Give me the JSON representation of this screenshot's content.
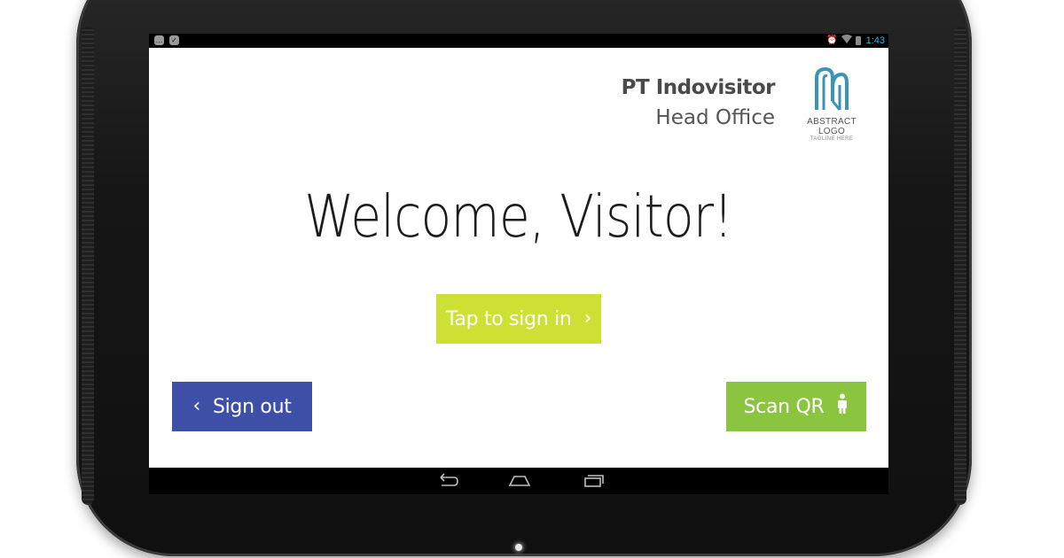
{
  "status_bar": {
    "time": "1:43",
    "notification_icons": [
      "chat-notification-icon",
      "checkbox-notification-icon"
    ],
    "system_icons": [
      "alarm-icon",
      "wifi-icon",
      "battery-icon"
    ]
  },
  "company": {
    "name": "PT Indovisitor",
    "branch": "Head Office"
  },
  "logo": {
    "text": "ABSTRACT LOGO",
    "tagline": "TAGLINE HERE",
    "color": "#3b93b8"
  },
  "welcome": {
    "text": "Welcome, Visitor!"
  },
  "buttons": {
    "sign_in": {
      "label": "Tap to sign in",
      "icon": "chevron-right-icon",
      "color": "#cde034"
    },
    "sign_out": {
      "label": "Sign out",
      "icon": "chevron-left-icon",
      "color": "#3e4fa8"
    },
    "scan_qr": {
      "label": "Scan QR",
      "icon": "person-icon",
      "color": "#8bc43f"
    }
  },
  "nav_bar": {
    "buttons": [
      "back-icon",
      "home-icon",
      "recent-apps-icon"
    ]
  }
}
